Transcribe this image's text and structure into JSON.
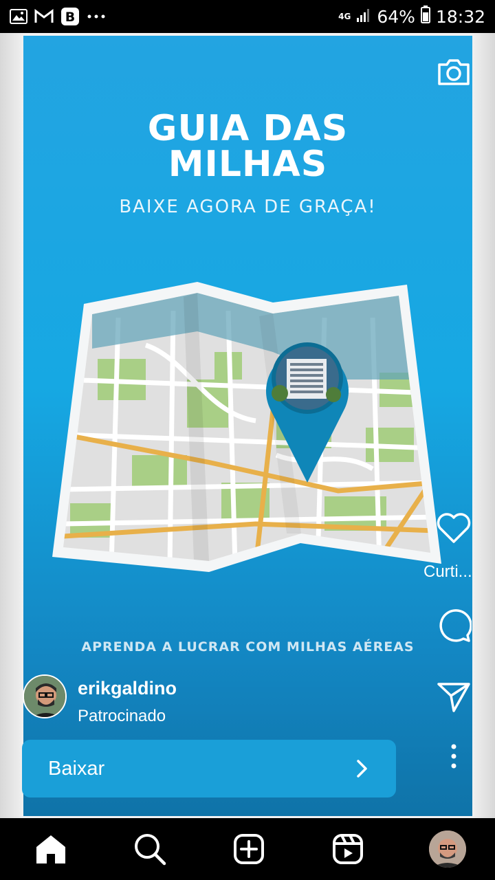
{
  "status_bar": {
    "network": "4G",
    "battery": "64%",
    "time": "18:32",
    "left_icons": [
      "image-icon",
      "gmail-icon",
      "b-app-icon",
      "more-notifications-icon"
    ]
  },
  "story": {
    "headline_line1": "GUIA DAS",
    "headline_line2": "MILHAS",
    "subheadline": "BAIXE AGORA DE GRAÇA!",
    "footline": "APRENDA A LUCRAR COM MILHAS AÉREAS",
    "username": "erikgaldino",
    "sponsored_label": "Patrocinado",
    "cta_label": "Baixar",
    "like_label": "Curti..."
  },
  "colors": {
    "story_blue": "#16a8e3",
    "cta_blue": "#1a9fd8",
    "map_green": "#a9cf86",
    "map_road": "#e8b04a"
  },
  "right_rail_icons": [
    "camera-icon",
    "heart-icon",
    "comment-icon",
    "send-icon",
    "more-options-icon"
  ],
  "nav_icons": [
    "home-icon",
    "search-icon",
    "create-icon",
    "reels-icon",
    "profile-avatar"
  ]
}
